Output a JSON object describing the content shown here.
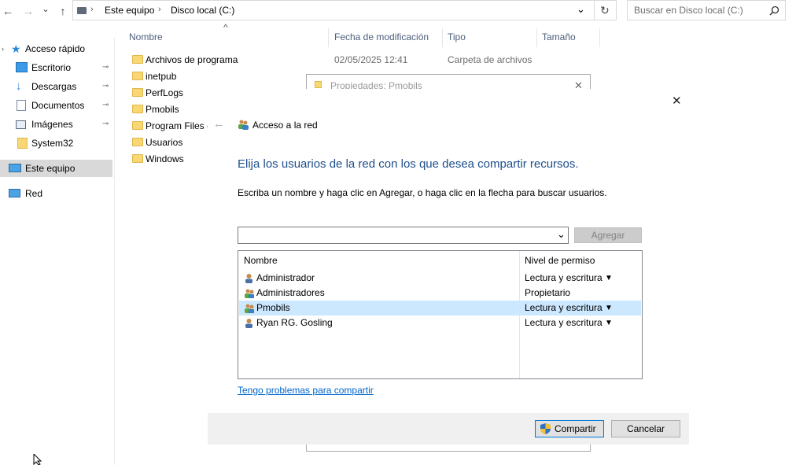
{
  "toolbar": {
    "back": "←",
    "forward": "→",
    "dropdown": "⌄",
    "up": "↑"
  },
  "address": {
    "segments": [
      "Este equipo",
      "Disco local (C:)"
    ],
    "separator": "›",
    "dropdown": "⌄",
    "refresh": "↻"
  },
  "search": {
    "placeholder": "Buscar en Disco local (C:)"
  },
  "sidebar": {
    "items": [
      {
        "label": "Acceso rápido"
      },
      {
        "label": "Escritorio",
        "pinned": true
      },
      {
        "label": "Descargas",
        "pinned": true
      },
      {
        "label": "Documentos",
        "pinned": true
      },
      {
        "label": "Imágenes",
        "pinned": true
      },
      {
        "label": "System32"
      },
      {
        "label": "Este equipo",
        "selected": true
      },
      {
        "label": "Red"
      }
    ],
    "pin_glyph": "📌"
  },
  "filelist": {
    "columns": [
      "Nombre",
      "Fecha de modificación",
      "Tipo",
      "Tamaño"
    ],
    "sort_indicator": "^",
    "rows": [
      {
        "name": "Archivos de programa",
        "date": "02/05/2025 12:41",
        "type": "Carpeta de archivos"
      },
      {
        "name": "inetpub"
      },
      {
        "name": "PerfLogs"
      },
      {
        "name": "Pmobils"
      },
      {
        "name": "Program Files ("
      },
      {
        "name": "Usuarios"
      },
      {
        "name": "Windows"
      }
    ]
  },
  "bg_dialog": {
    "title": "Propiedades: Pmobils",
    "close": "✕"
  },
  "share_dialog": {
    "close": "✕",
    "back": "←",
    "nav_title": "Acceso a la red",
    "heading": "Elija los usuarios de la red con los que desea compartir recursos.",
    "instruction": "Escriba un nombre y haga clic en Agregar, o haga clic en la flecha para buscar usuarios.",
    "combo_value": "",
    "combo_arrow": "⌄",
    "add_button": "Agregar",
    "table_headers": [
      "Nombre",
      "Nivel de permiso"
    ],
    "users": [
      {
        "name": "Administrador",
        "permission": "Lectura y escritura",
        "has_arrow": true,
        "group": false
      },
      {
        "name": "Administradores",
        "permission": "Propietario",
        "has_arrow": false,
        "group": true
      },
      {
        "name": "Pmobils",
        "permission": "Lectura y escritura",
        "has_arrow": true,
        "group": true,
        "selected": true
      },
      {
        "name": "Ryan RG. Gosling",
        "permission": "Lectura y escritura",
        "has_arrow": true,
        "group": false
      }
    ],
    "perm_arrow": "▼",
    "help_link": "Tengo problemas para compartir",
    "share_button": "Compartir",
    "cancel_button": "Cancelar"
  },
  "colors": {
    "heading_blue": "#1e4e8c",
    "link_blue": "#0066cc",
    "selected_row": "#cce8ff",
    "nav_selected": "#d9d9d9",
    "footer_bg": "#f0f0f0"
  }
}
